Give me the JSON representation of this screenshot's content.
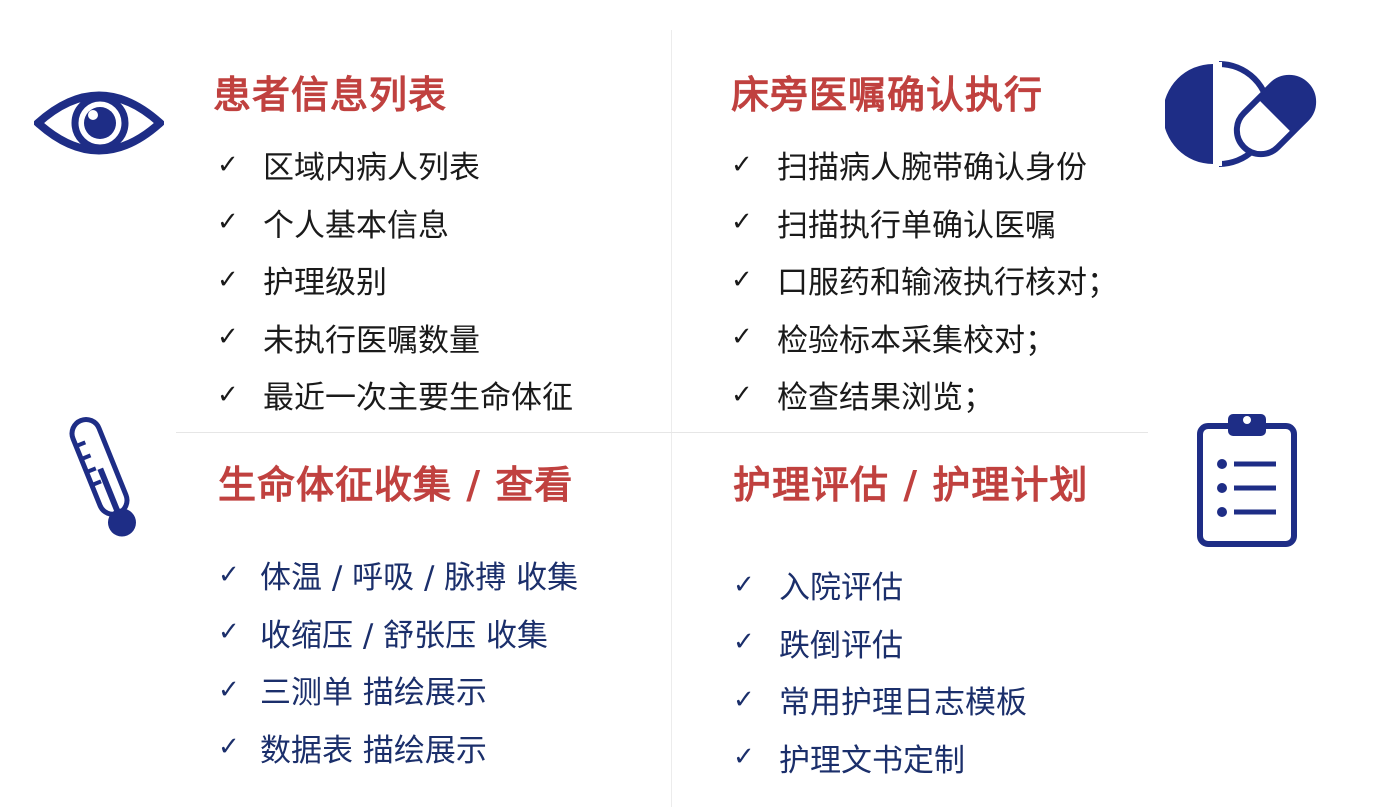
{
  "colors": {
    "title": "#c0413f",
    "dark_text": "#1a1a1a",
    "navy_text": "#1b2f6b",
    "icon_navy": "#1e2d86"
  },
  "icons": [
    "eye-icon",
    "pill-capsule-icon",
    "thermometer-icon",
    "clipboard-checklist-icon",
    "check-icon"
  ],
  "check_mark": "✓",
  "sections": {
    "patient_list": {
      "title": "患者信息列表",
      "items": [
        "区域内病人列表",
        "个人基本信息",
        "护理级别",
        "未执行医嘱数量",
        "最近一次主要生命体征"
      ]
    },
    "bedside_orders": {
      "title": "床旁医嘱确认执行",
      "items": [
        "扫描病人腕带确认身份",
        "扫描执行单确认医嘱",
        "口服药和输液执行核对；",
        "检验标本采集校对；",
        "检查结果浏览；"
      ]
    },
    "vital_signs": {
      "title": "生命体征收集 / 查看",
      "items": [
        "体温 / 呼吸 / 脉搏 收集",
        "收缩压 / 舒张压 收集",
        "三测单 描绘展示",
        "数据表 描绘展示"
      ]
    },
    "nursing_assessment": {
      "title": "护理评估 / 护理计划",
      "items": [
        "入院评估",
        "跌倒评估",
        "常用护理日志模板",
        "护理文书定制"
      ]
    }
  }
}
